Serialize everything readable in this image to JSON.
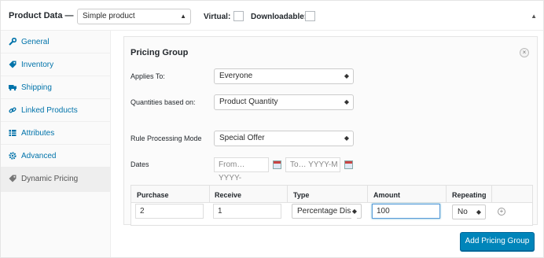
{
  "header": {
    "title": "Product Data —",
    "product_type": "Simple product",
    "virtual_label": "Virtual:",
    "downloadable_label": "Downloadable:"
  },
  "sidebar": {
    "items": [
      {
        "label": "General",
        "icon": "wrench-icon"
      },
      {
        "label": "Inventory",
        "icon": "tag-icon"
      },
      {
        "label": "Shipping",
        "icon": "truck-icon"
      },
      {
        "label": "Linked Products",
        "icon": "link-icon"
      },
      {
        "label": "Attributes",
        "icon": "table-icon"
      },
      {
        "label": "Advanced",
        "icon": "gear-icon"
      },
      {
        "label": "Dynamic Pricing",
        "icon": "tag-icon",
        "active": true
      }
    ]
  },
  "pricing_group": {
    "title": "Pricing Group",
    "applies_to_label": "Applies To:",
    "applies_to_value": "Everyone",
    "quantities_label": "Quantities based on:",
    "quantities_value": "Product Quantity",
    "rule_mode_label": "Rule Processing Mode",
    "rule_mode_value": "Special Offer",
    "dates_label": "Dates",
    "date_from_placeholder": "From… YYYY-",
    "date_to_placeholder": "To… YYYY-M"
  },
  "table": {
    "headers": [
      "Purchase",
      "Receive",
      "Type",
      "Amount",
      "Repeating"
    ],
    "row": {
      "purchase": "2",
      "receive": "1",
      "type": "Percentage Dis",
      "amount": "100",
      "repeating": "No"
    }
  },
  "add_button_label": "Add Pricing Group",
  "colors": {
    "accent": "#0073aa",
    "button": "#0085ba"
  }
}
